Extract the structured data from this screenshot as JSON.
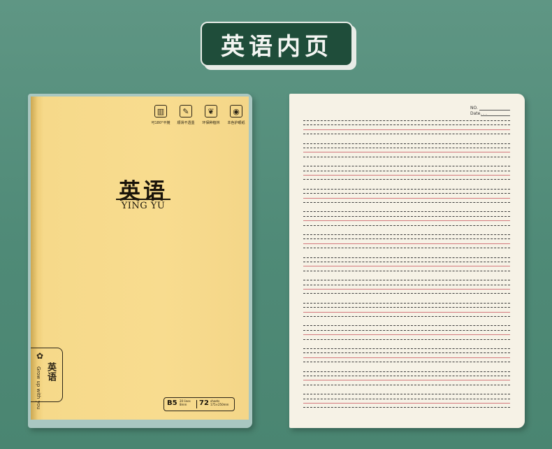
{
  "header": {
    "title": "英语内页"
  },
  "cover": {
    "title": "英语",
    "subtitle": "YING YU",
    "features": [
      {
        "icon": "book-open-180-icon",
        "glyph": "▥",
        "label": "可180°平摊"
      },
      {
        "icon": "pen-nib-icon",
        "glyph": "✎",
        "label": "顺滑不透墨"
      },
      {
        "icon": "leaf-eco-icon",
        "glyph": "❦",
        "label": "环保种植林"
      },
      {
        "icon": "eye-care-icon",
        "glyph": "◉",
        "label": "本色护眼纸"
      }
    ],
    "brand": {
      "icon": "flower-logo-icon",
      "name": "英语",
      "slogan": "Grow up with you"
    },
    "spec": {
      "size": "B5",
      "line_info": "20 lines 8mm",
      "count": "72",
      "sheet_info": "sheets 175×250mm"
    },
    "colors": {
      "cover": "#f8dc8f",
      "background": "#5f9684",
      "badge": "#1f4d3a"
    }
  },
  "inner_page": {
    "no_label": "NO.",
    "date_label": "Date.  .  .",
    "groups": 13,
    "colors": {
      "paper": "#f6f2e6",
      "dotted_line": "#3e3e3e",
      "red_line": "#d4787c"
    }
  }
}
